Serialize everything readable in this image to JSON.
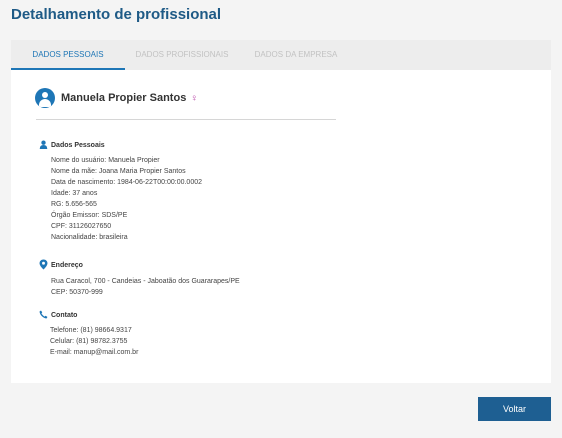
{
  "page": {
    "title": "Detalhamento de profissional"
  },
  "tabs": [
    {
      "label": "DADOS PESSOAIS",
      "active": true
    },
    {
      "label": "DADOS PROFISSIONAIS",
      "active": false
    },
    {
      "label": "DADOS DA EMPRESA",
      "active": false
    }
  ],
  "profile": {
    "name": "Manuela Propier Santos",
    "gender_symbol": "♀",
    "avatar_icon": "user-circle-icon"
  },
  "sections": {
    "personal": {
      "title": "Dados Pessoais",
      "icon": "person-icon",
      "lines": [
        "Nome do usuário: Manuela Propier",
        "Nome da mãe: Joana Maria Propier Santos",
        "Data de nascimento: 1984-06-22T00:00:00.0002",
        "Idade: 37 anos",
        "RG: 5.656-565",
        "Órgão Emissor: SDS/PE",
        "CPF: 31126027650",
        "Nacionalidade: brasileira"
      ]
    },
    "address": {
      "title": "Endereço",
      "icon": "map-pin-icon",
      "lines": [
        "Rua Caracol, 700 - Candeias - Jaboatão dos Guararapes/PE",
        "CEP: 50370-999"
      ]
    },
    "contact": {
      "title": "Contato",
      "icon": "phone-icon",
      "lines": [
        "Telefone: (81) 98664.9317",
        "Celular: (81) 98782.3755",
        "E-mail: manup@mail.com.br"
      ]
    }
  },
  "actions": {
    "back_label": "Voltar"
  },
  "colors": {
    "primary": "#1e76b6",
    "title": "#1e5a86",
    "button": "#1e5f92",
    "gender": "#b946a8"
  }
}
